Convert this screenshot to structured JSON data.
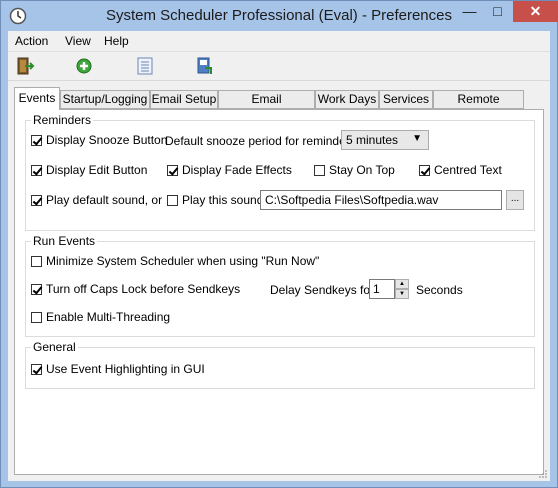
{
  "window": {
    "title": "System Scheduler Professional (Eval) - Preferences",
    "minimize": "—",
    "maximize": "□",
    "close": "✕"
  },
  "menu": [
    "Action",
    "View",
    "Help"
  ],
  "toolbar": {
    "icons": [
      "exit-icon",
      "add-icon",
      "list-icon",
      "save-icon"
    ]
  },
  "tabs": [
    "Events",
    "Startup/Logging",
    "Email Setup",
    "Email Notifications",
    "Work Days",
    "Services",
    "Remote Desktop"
  ],
  "active_tab": "Events",
  "reminders": {
    "label": "Reminders",
    "display_snooze": {
      "label": "Display Snooze Button",
      "checked": true
    },
    "snooze_period_label": "Default snooze period for reminders",
    "snooze_period_value": "5 minutes",
    "display_edit": {
      "label": "Display Edit Button",
      "checked": true
    },
    "display_fade": {
      "label": "Display Fade Effects",
      "checked": true
    },
    "stay_on_top": {
      "label": "Stay On Top",
      "checked": false
    },
    "centred_text": {
      "label": "Centred Text",
      "checked": true
    },
    "play_default": {
      "label": "Play default sound, or",
      "checked": true
    },
    "play_this": {
      "label": "Play this sound",
      "checked": false
    },
    "sound_path": "C:\\Softpedia Files\\Softpedia.wav",
    "browse": "..."
  },
  "run_events": {
    "label": "Run Events",
    "minimize": {
      "label": "Minimize System Scheduler when using \"Run Now\"",
      "checked": false
    },
    "caps_lock": {
      "label": "Turn off Caps Lock before Sendkeys",
      "checked": true
    },
    "delay_label": "Delay Sendkeys for",
    "delay_value": "1",
    "delay_unit": "Seconds",
    "multithreading": {
      "label": "Enable Multi-Threading",
      "checked": false
    }
  },
  "general": {
    "label": "General",
    "highlighting": {
      "label": "Use Event Highlighting in GUI",
      "checked": true
    }
  }
}
